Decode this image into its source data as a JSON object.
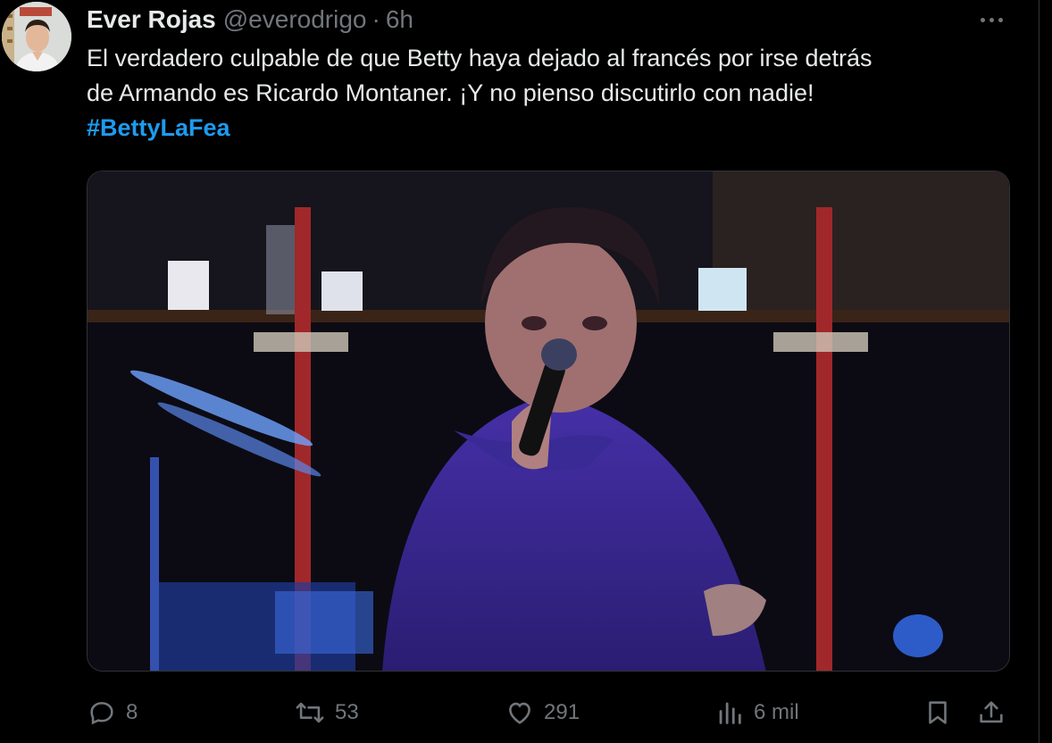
{
  "tweet": {
    "author_name": "Ever Rojas",
    "author_handle": "@everodrigo",
    "separator": "·",
    "time": "6h",
    "text_line1": "El verdadero culpable de que Betty haya dejado al francés por irse detrás",
    "text_line2": "de Armando es Ricardo Montaner. ¡Y no pienso discutirlo con nadie!",
    "hashtag": "#BettyLaFea"
  },
  "actions": {
    "replies": "8",
    "retweets": "53",
    "likes": "291",
    "views": "6 mil"
  },
  "icons": {
    "reply": "reply-icon",
    "retweet": "retweet-icon",
    "like": "heart-icon",
    "views": "views-icon",
    "bookmark": "bookmark-icon",
    "share": "share-icon",
    "more": "more-icon"
  },
  "colors": {
    "background": "#000000",
    "text": "#e7e9ea",
    "muted": "#71767b",
    "accent": "#1d9bf0"
  }
}
